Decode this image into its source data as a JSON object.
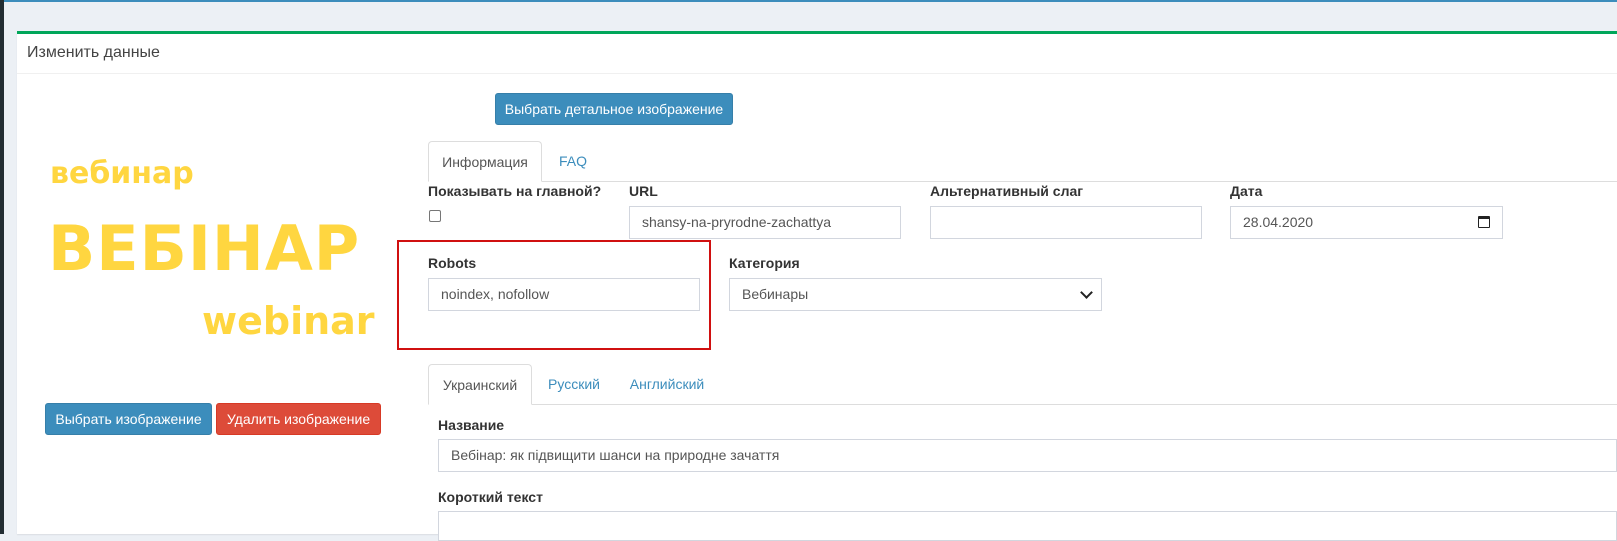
{
  "header": {
    "title": "Изменить данные"
  },
  "promo_image": {
    "line1": "вебинар",
    "line2": "ВЕБІНАР",
    "line3": "webinar"
  },
  "buttons": {
    "choose_detail_image": "Выбрать детальное изображение",
    "choose_image": "Выбрать изображение",
    "delete_image": "Удалить изображение"
  },
  "tabs_main": [
    {
      "label": "Информация",
      "active": true
    },
    {
      "label": "FAQ",
      "active": false
    }
  ],
  "fields": {
    "show_on_main": {
      "label": "Показывать на главной?",
      "checked": false
    },
    "url": {
      "label": "URL",
      "value": "shansy-na-pryrodne-zachattya"
    },
    "alt_slug": {
      "label": "Альтернативный слаг",
      "value": ""
    },
    "date": {
      "label": "Дата",
      "value": "28.04.2020"
    },
    "robots": {
      "label": "Robots",
      "value": "noindex, nofollow"
    },
    "category": {
      "label": "Категория",
      "value": "Вебинары"
    }
  },
  "tabs_lang": [
    {
      "label": "Украинский",
      "active": true
    },
    {
      "label": "Русский",
      "active": false
    },
    {
      "label": "Английский",
      "active": false
    }
  ],
  "content": {
    "name_label": "Название",
    "name_value": "Вебінар: як підвищити шанси на природне зачаття",
    "short_text_label": "Короткий текст"
  },
  "colors": {
    "primary": "#3c8dbc",
    "danger": "#dd4b39",
    "success_border": "#00a65a",
    "highlight": "#d01010",
    "promo_text": "#ffd640"
  }
}
